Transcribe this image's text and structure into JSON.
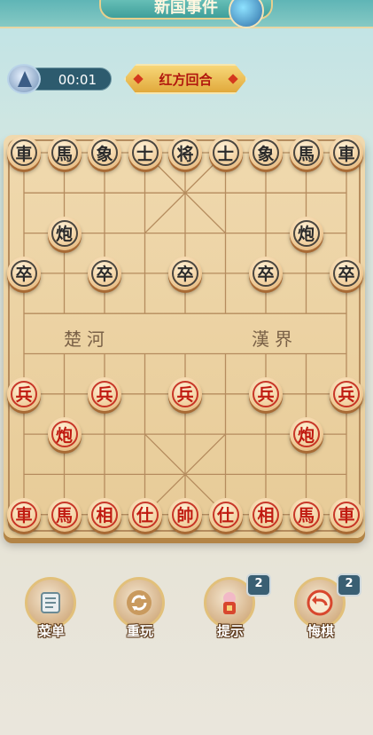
{
  "header": {
    "title": "新国事件"
  },
  "timer": {
    "value": "00:01"
  },
  "turn": {
    "label": "红方回合"
  },
  "board": {
    "river_left": "楚河",
    "river_right": "漢界",
    "pieces": [
      {
        "side": "black",
        "char": "車",
        "col": 0,
        "row": 0
      },
      {
        "side": "black",
        "char": "馬",
        "col": 1,
        "row": 0
      },
      {
        "side": "black",
        "char": "象",
        "col": 2,
        "row": 0
      },
      {
        "side": "black",
        "char": "士",
        "col": 3,
        "row": 0
      },
      {
        "side": "black",
        "char": "将",
        "col": 4,
        "row": 0
      },
      {
        "side": "black",
        "char": "士",
        "col": 5,
        "row": 0
      },
      {
        "side": "black",
        "char": "象",
        "col": 6,
        "row": 0
      },
      {
        "side": "black",
        "char": "馬",
        "col": 7,
        "row": 0
      },
      {
        "side": "black",
        "char": "車",
        "col": 8,
        "row": 0
      },
      {
        "side": "black",
        "char": "炮",
        "col": 1,
        "row": 2
      },
      {
        "side": "black",
        "char": "炮",
        "col": 7,
        "row": 2
      },
      {
        "side": "black",
        "char": "卒",
        "col": 0,
        "row": 3
      },
      {
        "side": "black",
        "char": "卒",
        "col": 2,
        "row": 3
      },
      {
        "side": "black",
        "char": "卒",
        "col": 4,
        "row": 3
      },
      {
        "side": "black",
        "char": "卒",
        "col": 6,
        "row": 3
      },
      {
        "side": "black",
        "char": "卒",
        "col": 8,
        "row": 3
      },
      {
        "side": "red",
        "char": "兵",
        "col": 0,
        "row": 6
      },
      {
        "side": "red",
        "char": "兵",
        "col": 2,
        "row": 6
      },
      {
        "side": "red",
        "char": "兵",
        "col": 4,
        "row": 6
      },
      {
        "side": "red",
        "char": "兵",
        "col": 6,
        "row": 6
      },
      {
        "side": "red",
        "char": "兵",
        "col": 8,
        "row": 6
      },
      {
        "side": "red",
        "char": "炮",
        "col": 1,
        "row": 7
      },
      {
        "side": "red",
        "char": "炮",
        "col": 7,
        "row": 7
      },
      {
        "side": "red",
        "char": "車",
        "col": 0,
        "row": 9
      },
      {
        "side": "red",
        "char": "馬",
        "col": 1,
        "row": 9
      },
      {
        "side": "red",
        "char": "相",
        "col": 2,
        "row": 9
      },
      {
        "side": "red",
        "char": "仕",
        "col": 3,
        "row": 9
      },
      {
        "side": "red",
        "char": "帥",
        "col": 4,
        "row": 9
      },
      {
        "side": "red",
        "char": "仕",
        "col": 5,
        "row": 9
      },
      {
        "side": "red",
        "char": "相",
        "col": 6,
        "row": 9
      },
      {
        "side": "red",
        "char": "馬",
        "col": 7,
        "row": 9
      },
      {
        "side": "red",
        "char": "車",
        "col": 8,
        "row": 9
      }
    ]
  },
  "controls": {
    "menu": {
      "label": "菜单",
      "icon": "scroll-icon"
    },
    "replay": {
      "label": "重玩",
      "icon": "refresh-icon"
    },
    "hint": {
      "label": "提示",
      "icon": "lantern-icon",
      "count": "2"
    },
    "undo": {
      "label": "悔棋",
      "icon": "undo-arrow-icon",
      "count": "2"
    }
  },
  "colors": {
    "red_piece": "#c01a10",
    "black_piece": "#2b2b2b",
    "board": "#ecd3a5"
  }
}
